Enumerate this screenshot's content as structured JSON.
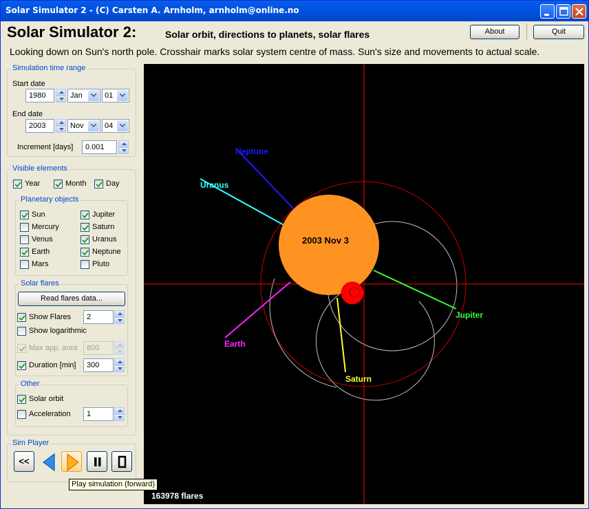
{
  "window": {
    "title": "Solar Simulator 2 - (C) Carsten A. Arnholm, arnholm@online.no"
  },
  "header": {
    "title": "Solar Simulator 2:",
    "subtitle": "Solar orbit, directions to planets, solar flares",
    "description": "Looking down on Sun's north pole. Crosshair marks solar system centre of mass. Sun's size and movements to actual scale.",
    "about_label": "About",
    "quit_label": "Quit"
  },
  "time_range": {
    "title": "Simulation time range",
    "start_label": "Start date",
    "start_year": "1980",
    "start_month": "Jan",
    "start_day": "01",
    "end_label": "End date",
    "end_year": "2003",
    "end_month": "Nov",
    "end_day": "04",
    "increment_label": "Increment [days]",
    "increment_value": "0.001"
  },
  "visible": {
    "title": "Visible elements",
    "year_label": "Year",
    "month_label": "Month",
    "day_label": "Day",
    "year_checked": true,
    "month_checked": true,
    "day_checked": true
  },
  "planetary": {
    "title": "Planetary objects",
    "items": [
      {
        "label": "Sun",
        "checked": true
      },
      {
        "label": "Jupiter",
        "checked": true
      },
      {
        "label": "Mercury",
        "checked": false
      },
      {
        "label": "Saturn",
        "checked": true
      },
      {
        "label": "Venus",
        "checked": false
      },
      {
        "label": "Uranus",
        "checked": true
      },
      {
        "label": "Earth",
        "checked": true
      },
      {
        "label": "Neptune",
        "checked": true
      },
      {
        "label": "Mars",
        "checked": false
      },
      {
        "label": "Pluto",
        "checked": false
      }
    ]
  },
  "flares": {
    "title": "Solar flares",
    "read_label": "Read flares data...",
    "show_label": "Show Flares",
    "show_checked": true,
    "show_value": "2",
    "log_label": "Show logarithmic",
    "log_checked": false,
    "max_label": "Max app. area",
    "max_checked": true,
    "max_value": "800",
    "duration_label": "Duration [min]",
    "duration_checked": true,
    "duration_value": "300"
  },
  "other": {
    "title": "Other",
    "orbit_label": "Solar orbit",
    "orbit_checked": true,
    "accel_label": "Acceleration",
    "accel_checked": false,
    "accel_value": "1"
  },
  "player": {
    "title": "Sim Player",
    "rewind_label": "<<",
    "tooltip": "Play simulation (forward)"
  },
  "view": {
    "date": "2003 Nov 3",
    "flare_count": "163978 flares",
    "planets": [
      {
        "name": "Neptune",
        "color": "#1a1aff"
      },
      {
        "name": "Uranus",
        "color": "#33ffff"
      },
      {
        "name": "Earth",
        "color": "#ff22ff"
      },
      {
        "name": "Saturn",
        "color": "#ffff33"
      },
      {
        "name": "Jupiter",
        "color": "#33ff33"
      }
    ],
    "sun_color": "#ff9322",
    "crosshair_color": "#ff0000"
  }
}
